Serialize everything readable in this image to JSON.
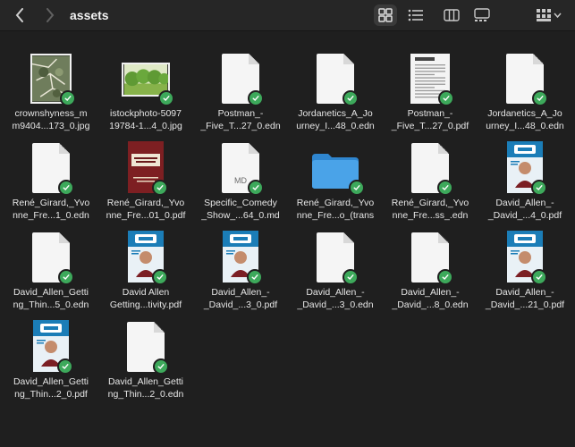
{
  "window": {
    "title": "assets"
  },
  "toolbar": {
    "back_icon": "chevron-left-icon",
    "forward_icon": "chevron-right-icon",
    "view_icons": [
      "grid-view-icon",
      "list-view-icon",
      "column-view-icon",
      "gallery-view-icon",
      "group-menu-icon"
    ]
  },
  "colors": {
    "badge_green": "#3da95b",
    "folder_blue": "#4aa3e8",
    "background": "#1f1f1f"
  },
  "files": [
    {
      "name": "crownshyness_m\nm9404...173_0.jpg",
      "kind": "map-photo"
    },
    {
      "name": "istockphoto-5097\n19784-1...4_0.jpg",
      "kind": "park-photo"
    },
    {
      "name": "Postman_-\n_Five_T...27_0.edn",
      "kind": "doc"
    },
    {
      "name": "Jordanetics_A_Jo\nurney_I...48_0.edn",
      "kind": "doc"
    },
    {
      "name": "Postman_-\n_Five_T...27_0.pdf",
      "kind": "pdf-text"
    },
    {
      "name": "Jordanetics_A_Jo\nurney_I...48_0.edn",
      "kind": "doc"
    },
    {
      "name": "René_Girard,_Yvo\nnne_Fre...1_0.edn",
      "kind": "doc"
    },
    {
      "name": "René_Girard,_Yvo\nnne_Fre...01_0.pdf",
      "kind": "book-red"
    },
    {
      "name": "Specific_Comedy\n_Show_...64_0.md",
      "kind": "doc-md",
      "label": "MD"
    },
    {
      "name": "René_Girard,_Yvo\nnne_Fre...o_(trans",
      "kind": "folder"
    },
    {
      "name": "René_Girard,_Yvo\nnne_Fre...ss_.edn",
      "kind": "doc"
    },
    {
      "name": "David_Allen_-\n_David_...4_0.pdf",
      "kind": "book-gtd"
    },
    {
      "name": "David_Allen_Getti\nng_Thin...5_0.edn",
      "kind": "doc"
    },
    {
      "name": "David Allen\nGetting...tivity.pdf",
      "kind": "book-gtd"
    },
    {
      "name": "David_Allen_-\n_David_...3_0.pdf",
      "kind": "book-gtd"
    },
    {
      "name": "David_Allen_-\n_David_...3_0.edn",
      "kind": "doc"
    },
    {
      "name": "David_Allen_-\n_David_...8_0.edn",
      "kind": "doc"
    },
    {
      "name": "David_Allen_-\n_David_...21_0.pdf",
      "kind": "book-gtd"
    },
    {
      "name": "David_Allen_Getti\nng_Thin...2_0.pdf",
      "kind": "book-gtd"
    },
    {
      "name": "David_Allen_Getti\nng_Thin...2_0.edn",
      "kind": "doc"
    }
  ]
}
